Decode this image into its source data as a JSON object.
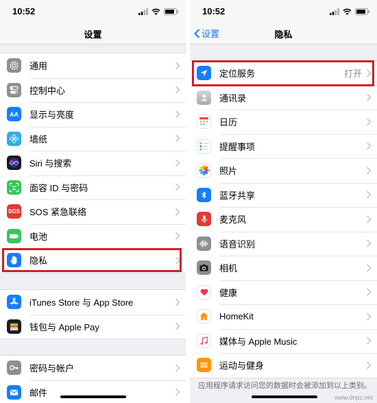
{
  "left": {
    "time": "10:52",
    "title": "设置",
    "group1": [
      {
        "label": "通用",
        "icon": "gear-icon",
        "color": "#8e8e93"
      },
      {
        "label": "控制中心",
        "icon": "toggles-icon",
        "color": "#8e8e93"
      },
      {
        "label": "显示与亮度",
        "icon": "aa-icon",
        "color": "#147efb"
      },
      {
        "label": "墙纸",
        "icon": "flower-icon",
        "color": "#32ade6"
      },
      {
        "label": "Siri 与搜索",
        "icon": "siri-icon",
        "color": "#1c1c1e"
      },
      {
        "label": "面容 ID 与密码",
        "icon": "face-id-icon",
        "color": "#34c759"
      },
      {
        "label": "SOS 紧急联络",
        "icon": "sos-icon",
        "color": "#e53935"
      },
      {
        "label": "电池",
        "icon": "battery-icon",
        "color": "#34c759"
      },
      {
        "label": "隐私",
        "icon": "hand-icon",
        "color": "#147efb"
      }
    ],
    "sos_text": "SOS",
    "aa_text": "AA",
    "group2": [
      {
        "label": "iTunes Store 与 App Store",
        "icon": "app-store-icon",
        "color": "#147efb"
      },
      {
        "label": "钱包与 Apple Pay",
        "icon": "wallet-icon",
        "color": "#1c1c1e"
      }
    ],
    "group3": [
      {
        "label": "密码与帐户",
        "icon": "key-icon",
        "color": "#8e8e93"
      },
      {
        "label": "邮件",
        "icon": "mail-icon",
        "color": "#147efb"
      }
    ]
  },
  "right": {
    "time": "10:52",
    "back_label": "设置",
    "title": "隐私",
    "rows": [
      {
        "label": "定位服务",
        "value": "打开",
        "icon": "location-arrow-icon",
        "color": "#147efb"
      },
      {
        "label": "通讯录",
        "value": "",
        "icon": "contacts-icon",
        "color": "#b8b8bd"
      },
      {
        "label": "日历",
        "value": "",
        "icon": "calendar-icon",
        "color": "#ffffff"
      },
      {
        "label": "提醒事项",
        "value": "",
        "icon": "reminders-icon",
        "color": "#ffffff"
      },
      {
        "label": "照片",
        "value": "",
        "icon": "photos-icon",
        "color": "#ffffff"
      },
      {
        "label": "蓝牙共享",
        "value": "",
        "icon": "bluetooth-icon",
        "color": "#147efb"
      },
      {
        "label": "麦克风",
        "value": "",
        "icon": "microphone-icon",
        "color": "#e53935"
      },
      {
        "label": "语音识别",
        "value": "",
        "icon": "waveform-icon",
        "color": "#8e8e93"
      },
      {
        "label": "相机",
        "value": "",
        "icon": "camera-icon",
        "color": "#8e8e93"
      },
      {
        "label": "健康",
        "value": "",
        "icon": "heart-icon",
        "color": "#ffffff"
      },
      {
        "label": "HomeKit",
        "value": "",
        "icon": "home-icon",
        "color": "#ffffff"
      },
      {
        "label": "媒体与 Apple Music",
        "value": "",
        "icon": "music-note-icon",
        "color": "#ffffff"
      },
      {
        "label": "运动与健身",
        "value": "",
        "icon": "fitness-icon",
        "color": "#ff9500"
      }
    ],
    "footnote": "应用程序请求访问您的数据时会被添加到以上类别。"
  },
  "accent": "#147efb",
  "highlight_color": "#d11d24",
  "watermark": "www.dnpz.net"
}
